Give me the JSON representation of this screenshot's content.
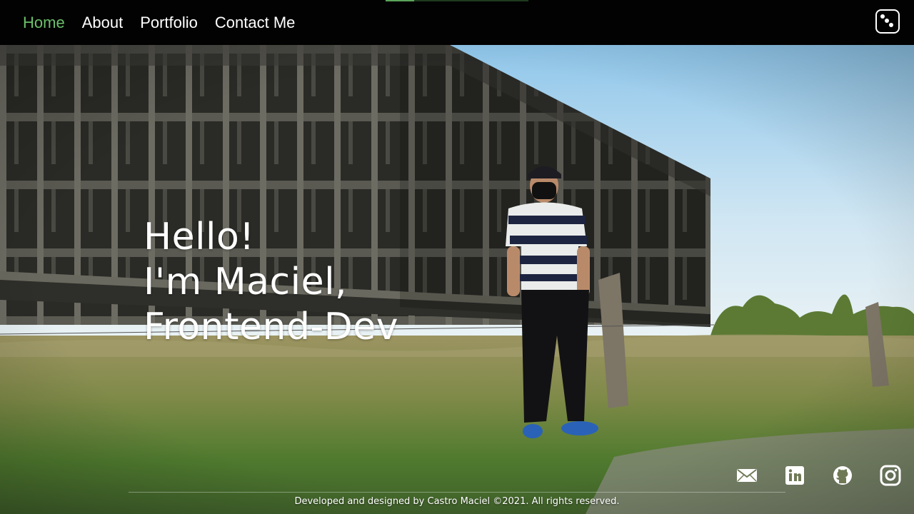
{
  "nav": {
    "links": [
      {
        "label": "Home",
        "active": true
      },
      {
        "label": "About",
        "active": false
      },
      {
        "label": "Portfolio",
        "active": false
      },
      {
        "label": "Contact Me",
        "active": false
      }
    ],
    "theme_toggle_icon": "dice-icon"
  },
  "hero": {
    "greeting_line1": "Hello!",
    "greeting_line2": "I'm Maciel,",
    "greeting_line3": "Frontend-Dev"
  },
  "social": [
    {
      "name": "email",
      "icon": "envelope-icon"
    },
    {
      "name": "linkedin",
      "icon": "linkedin-icon"
    },
    {
      "name": "github",
      "icon": "github-icon"
    },
    {
      "name": "instagram",
      "icon": "instagram-icon"
    }
  ],
  "footer": {
    "text": "Developed and designed by Castro Maciel ©2021. All rights reserved."
  },
  "colors": {
    "nav_bg": "#020202",
    "active_link": "#6bbf6b",
    "text": "#ffffff"
  }
}
